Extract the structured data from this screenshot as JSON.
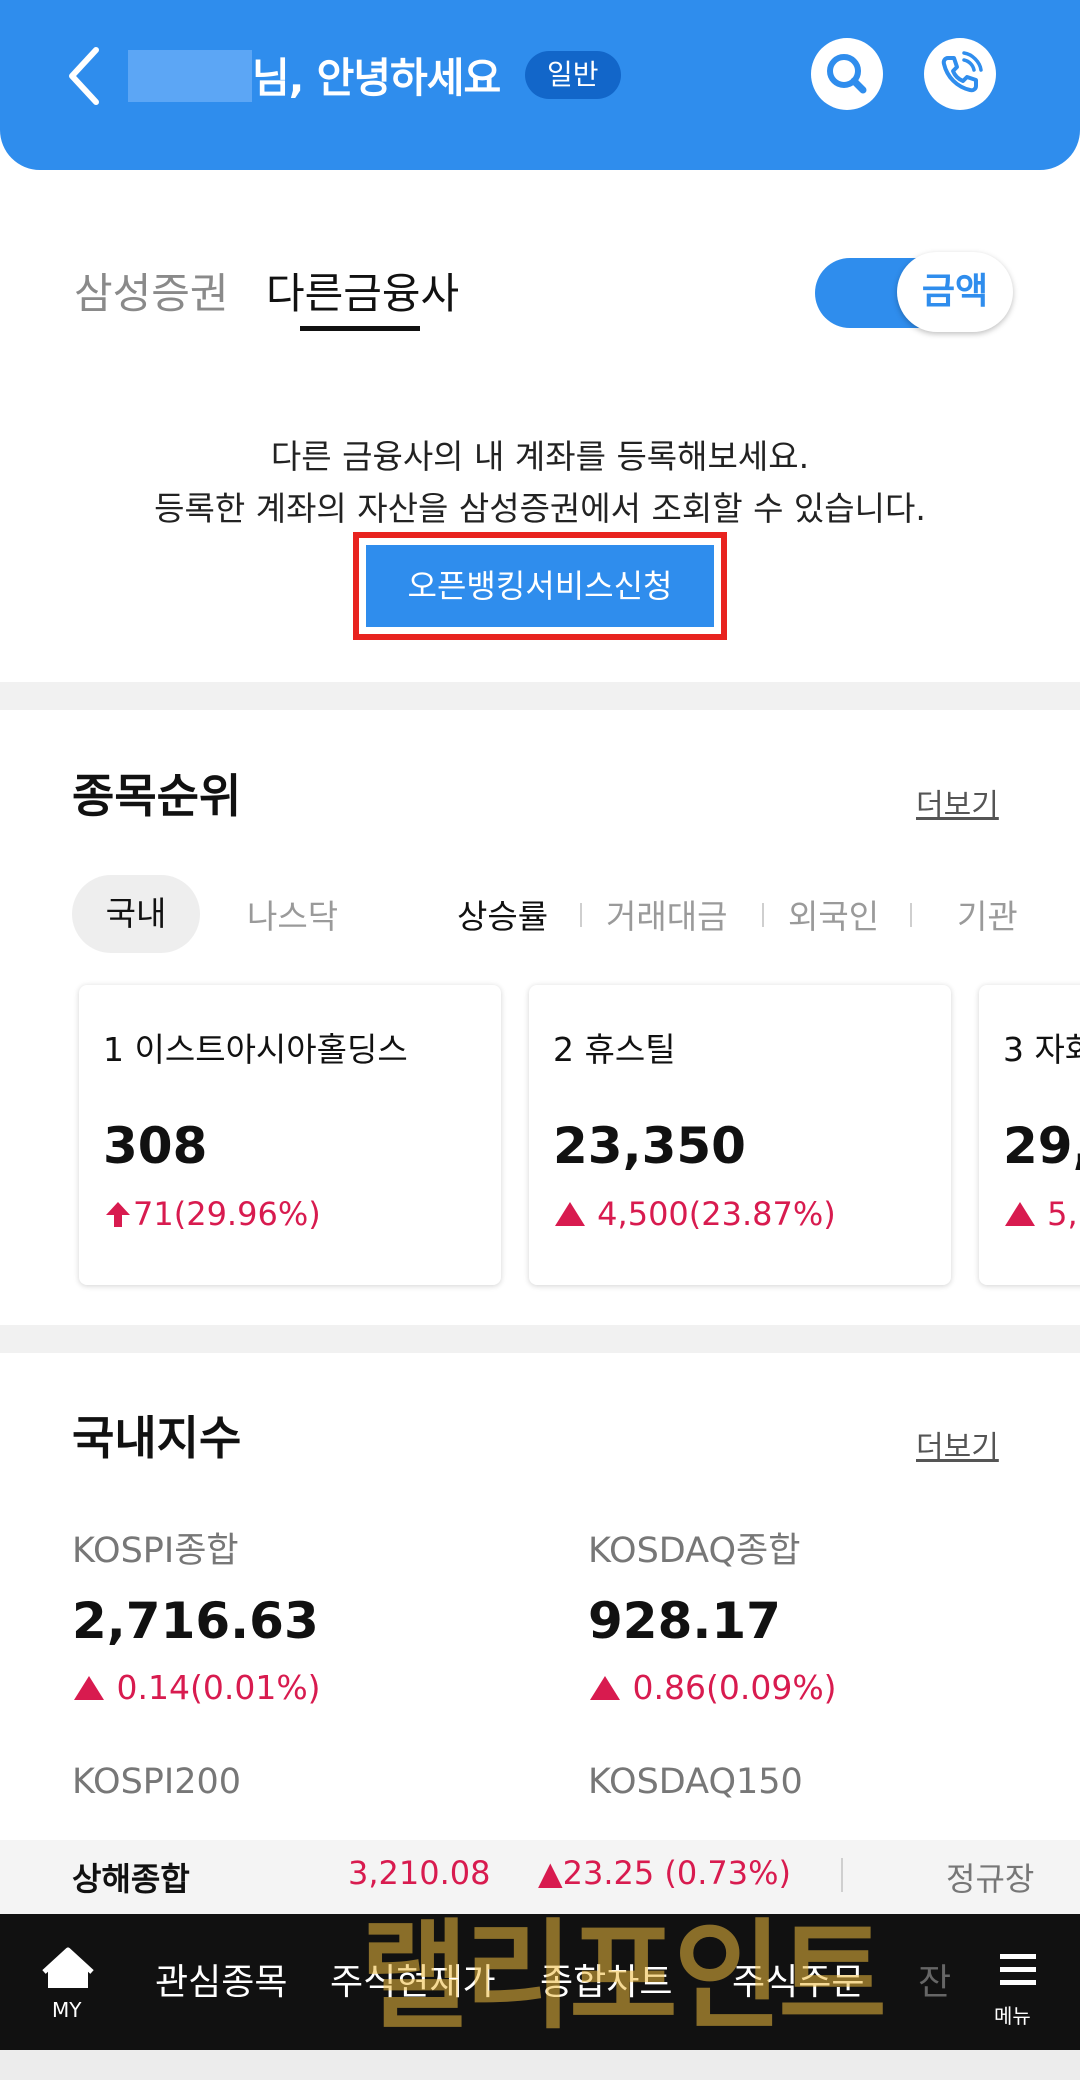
{
  "header": {
    "greeting": "님, 안녕하세요",
    "grade": "일반"
  },
  "tabs": [
    {
      "label": "삼성증권"
    },
    {
      "label": "다른금융사"
    }
  ],
  "toggle": {
    "label": "금액"
  },
  "promo": {
    "line1": "다른 금융사의 내 계좌를 등록해보세요.",
    "line2": "등록한 계좌의 자산을 삼성증권에서 조회할 수 있습니다.",
    "button": "오픈뱅킹서비스신청"
  },
  "ranking": {
    "title": "종목순위",
    "more": "더보기",
    "markets": [
      "국내",
      "나스닥"
    ],
    "filters": [
      "상승률",
      "거래대금",
      "외국인",
      "기관"
    ],
    "cards": [
      {
        "rank_name": "1 이스트아시아홀딩스",
        "price": "308",
        "change": "71(29.96%)"
      },
      {
        "rank_name": "2 휴스틸",
        "price": "23,350",
        "change": "4,500(23.87%)"
      },
      {
        "rank_name": "3 자화",
        "price": "29,",
        "change": "5,"
      }
    ]
  },
  "indices": {
    "title": "국내지수",
    "more": "더보기",
    "items": [
      {
        "name": "KOSPI종합",
        "value": "2,716.63",
        "change": "0.14(0.01%)"
      },
      {
        "name": "KOSDAQ종합",
        "value": "928.17",
        "change": "0.86(0.09%)"
      },
      {
        "name": "KOSPI200"
      },
      {
        "name": "KOSDAQ150"
      }
    ]
  },
  "ticker": {
    "name": "상해종합",
    "value": "3,210.08",
    "change": "▲23.25 (0.73%)",
    "session": "정규장"
  },
  "nav": {
    "home": "MY",
    "items": [
      "관심종목",
      "주식현재가",
      "종합차트",
      "주식주문",
      "잔"
    ],
    "menu": "메뉴"
  },
  "watermark": "랠리포인트",
  "colors": {
    "brand": "#2f8ded",
    "up": "#d81b4f",
    "highlight": "#e8231f"
  }
}
